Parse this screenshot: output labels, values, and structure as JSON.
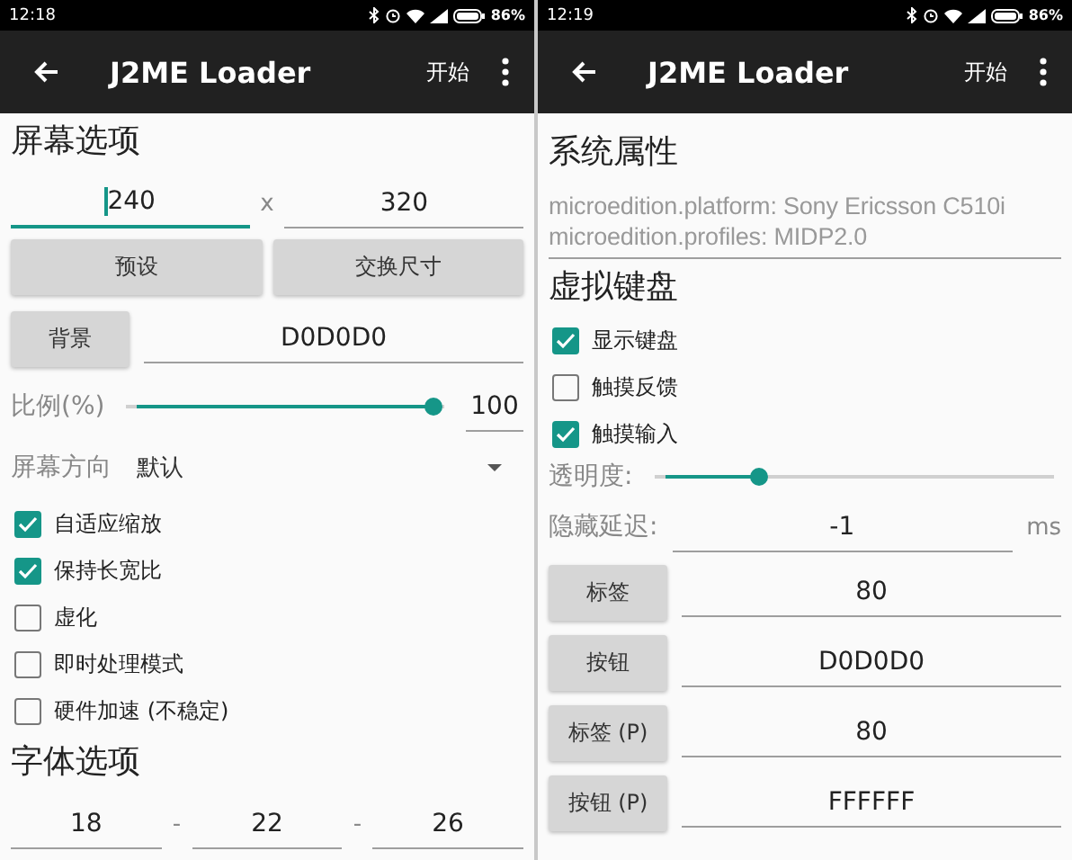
{
  "screens": [
    {
      "status_bar": {
        "time": "12:18",
        "battery": "86%"
      },
      "app_bar": {
        "title": "J2ME Loader",
        "action": "开始"
      },
      "content": [
        {
          "kind": "heading",
          "text": "屏幕选项"
        },
        {
          "kind": "fields",
          "fields": [
            {
              "value": "240",
              "focused": true
            },
            {
              "value": "320",
              "focused": false
            }
          ],
          "separators": [
            "x"
          ]
        },
        {
          "kind": "buttons",
          "labels": [
            "预设",
            "交换尺寸"
          ]
        },
        {
          "kind": "button_field",
          "button": "背景",
          "value": "D0D0D0"
        },
        {
          "kind": "slider",
          "label": "比例(%)",
          "level": 1.0,
          "value": "100"
        },
        {
          "kind": "dropdown",
          "label": "屏幕方向",
          "value": "默认"
        },
        {
          "kind": "checkbox",
          "label": "自适应缩放",
          "checked": true
        },
        {
          "kind": "checkbox",
          "label": "保持长宽比",
          "checked": true
        },
        {
          "kind": "checkbox",
          "label": "虚化",
          "checked": false
        },
        {
          "kind": "checkbox",
          "label": "即时处理模式",
          "checked": false
        },
        {
          "kind": "checkbox",
          "label": "硬件加速 (不稳定)",
          "checked": false
        },
        {
          "kind": "heading",
          "text": "字体选项"
        },
        {
          "kind": "fields",
          "fields": [
            {
              "value": "18",
              "focused": false
            },
            {
              "value": "22",
              "focused": false
            },
            {
              "value": "26",
              "focused": false
            }
          ],
          "separators": [
            "-",
            "-"
          ]
        }
      ]
    },
    {
      "status_bar": {
        "time": "12:19",
        "battery": "86%"
      },
      "app_bar": {
        "title": "J2ME Loader",
        "action": "开始"
      },
      "content": [
        {
          "kind": "heading",
          "text": "系统属性"
        },
        {
          "kind": "text_area",
          "value": "microedition.platform: Sony Ericsson C510i\nmicroedition.profiles: MIDP2.0"
        },
        {
          "kind": "heading",
          "text": "虚拟键盘"
        },
        {
          "kind": "checkbox",
          "label": "显示键盘",
          "checked": true
        },
        {
          "kind": "checkbox",
          "label": "触摸反馈",
          "checked": false
        },
        {
          "kind": "checkbox",
          "label": "触摸输入",
          "checked": true
        },
        {
          "kind": "slider",
          "label": "透明度:",
          "level": 0.25
        },
        {
          "kind": "unit_field",
          "label": "隐藏延迟:",
          "value": "-1",
          "unit": "ms"
        },
        {
          "kind": "button_field",
          "button": "标签",
          "value": "80"
        },
        {
          "kind": "button_field",
          "button": "按钮",
          "value": "D0D0D0"
        },
        {
          "kind": "button_field",
          "button": "标签 (P)",
          "value": "80"
        },
        {
          "kind": "button_field",
          "button": "按钮 (P)",
          "value": "FFFFFF"
        }
      ]
    }
  ]
}
